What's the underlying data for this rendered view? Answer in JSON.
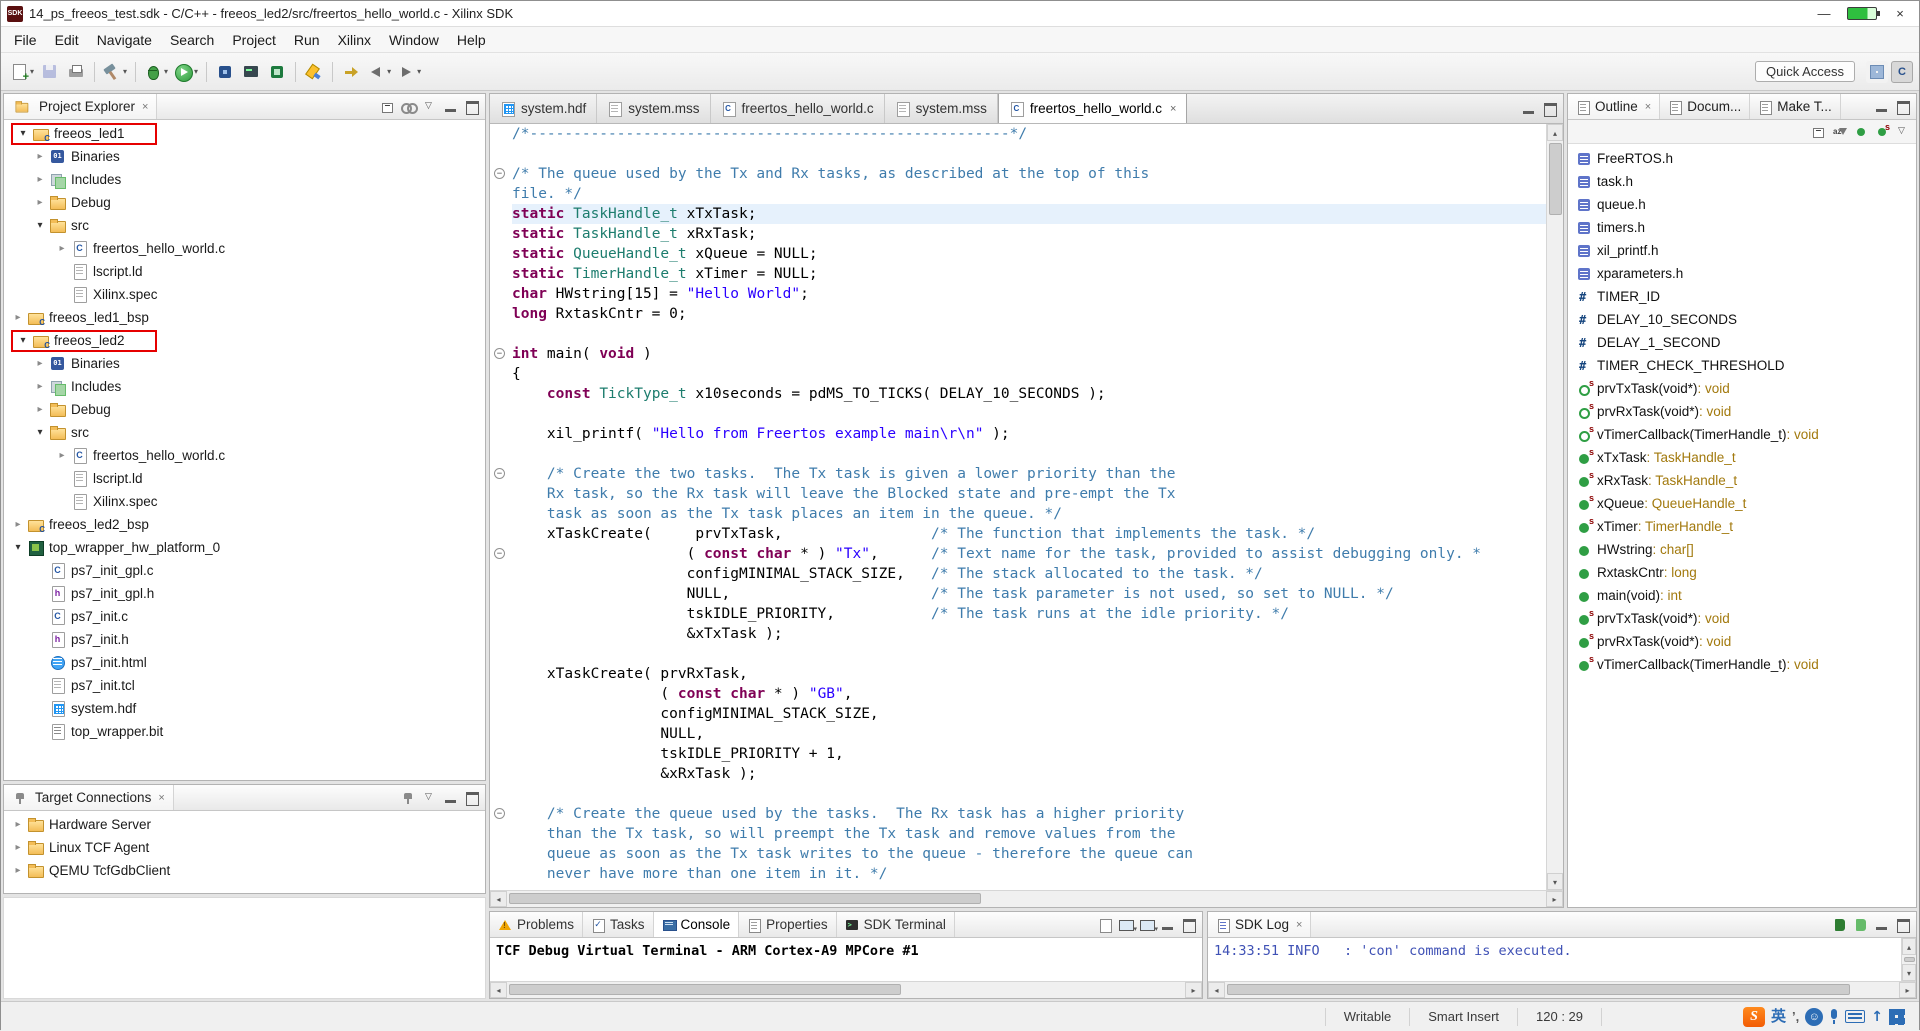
{
  "titlebar": {
    "title": "14_ps_freeos_test.sdk - C/C++ - freeos_led2/src/freertos_hello_world.c - Xilinx SDK",
    "app_badge": "SDK"
  },
  "menus": [
    "File",
    "Edit",
    "Navigate",
    "Search",
    "Project",
    "Run",
    "Xilinx",
    "Window",
    "Help"
  ],
  "toolbar": {
    "quick_access": "Quick Access",
    "items": [
      {
        "name": "new-wizard",
        "kind": "page-plus",
        "dd": true
      },
      {
        "name": "save",
        "kind": "floppy",
        "disabled": true
      },
      {
        "name": "print",
        "kind": "printer"
      },
      {
        "sep": true
      },
      {
        "name": "build",
        "kind": "hammer",
        "dd": true
      },
      {
        "sep": true
      },
      {
        "name": "debug",
        "kind": "bug",
        "dd": true
      },
      {
        "name": "run",
        "kind": "play",
        "dd": true
      },
      {
        "sep": true
      },
      {
        "name": "program-fpga",
        "kind": "chip"
      },
      {
        "name": "launch-shell",
        "kind": "terminal"
      },
      {
        "name": "create-boot-image",
        "kind": "chip2"
      },
      {
        "sep": true
      },
      {
        "name": "toggle-mark-occurrences",
        "kind": "marker"
      },
      {
        "sep": true
      },
      {
        "name": "last-edit-location",
        "kind": "edit-arrow"
      },
      {
        "name": "back",
        "kind": "arrow-left",
        "dd": true
      },
      {
        "name": "forward",
        "kind": "arrow-right",
        "dd": true
      }
    ]
  },
  "project_explorer": {
    "title": "Project Explorer",
    "items": [
      {
        "depth": 0,
        "arrow": "expanded",
        "icon": "folder-c",
        "label": "freeos_led1",
        "boxed": true
      },
      {
        "depth": 1,
        "arrow": "collapsed",
        "icon": "bin",
        "label": "Binaries"
      },
      {
        "depth": 1,
        "arrow": "collapsed",
        "icon": "inc",
        "label": "Includes"
      },
      {
        "depth": 1,
        "arrow": "collapsed",
        "icon": "folder",
        "label": "Debug"
      },
      {
        "depth": 1,
        "arrow": "expanded",
        "icon": "folder",
        "label": "src"
      },
      {
        "depth": 2,
        "arrow": "collapsed",
        "icon": "cfile",
        "label": "freertos_hello_world.c"
      },
      {
        "depth": 2,
        "arrow": null,
        "icon": "ldfile",
        "label": "lscript.ld"
      },
      {
        "depth": 2,
        "arrow": null,
        "icon": "specfile",
        "label": "Xilinx.spec"
      },
      {
        "depth": 0,
        "arrow": "collapsed",
        "icon": "folder-c",
        "label": "freeos_led1_bsp"
      },
      {
        "depth": 0,
        "arrow": "expanded",
        "icon": "folder-c",
        "label": "freeos_led2",
        "boxed": true
      },
      {
        "depth": 1,
        "arrow": "collapsed",
        "icon": "bin",
        "label": "Binaries"
      },
      {
        "depth": 1,
        "arrow": "collapsed",
        "icon": "inc",
        "label": "Includes"
      },
      {
        "depth": 1,
        "arrow": "collapsed",
        "icon": "folder",
        "label": "Debug"
      },
      {
        "depth": 1,
        "arrow": "expanded",
        "icon": "folder",
        "label": "src"
      },
      {
        "depth": 2,
        "arrow": "collapsed",
        "icon": "cfile",
        "label": "freertos_hello_world.c"
      },
      {
        "depth": 2,
        "arrow": null,
        "icon": "ldfile",
        "label": "lscript.ld"
      },
      {
        "depth": 2,
        "arrow": null,
        "icon": "specfile",
        "label": "Xilinx.spec"
      },
      {
        "depth": 0,
        "arrow": "collapsed",
        "icon": "folder-c",
        "label": "freeos_led2_bsp"
      },
      {
        "depth": 0,
        "arrow": "expanded",
        "icon": "board",
        "label": "top_wrapper_hw_platform_0"
      },
      {
        "depth": 1,
        "arrow": null,
        "icon": "cfile",
        "label": "ps7_init_gpl.c"
      },
      {
        "depth": 1,
        "arrow": null,
        "icon": "hfile",
        "label": "ps7_init_gpl.h"
      },
      {
        "depth": 1,
        "arrow": null,
        "icon": "cfile",
        "label": "ps7_init.c"
      },
      {
        "depth": 1,
        "arrow": null,
        "icon": "hfile",
        "label": "ps7_init.h"
      },
      {
        "depth": 1,
        "arrow": null,
        "icon": "htmlfile",
        "label": "ps7_init.html"
      },
      {
        "depth": 1,
        "arrow": null,
        "icon": "tclfile",
        "label": "ps7_init.tcl"
      },
      {
        "depth": 1,
        "arrow": null,
        "icon": "hdffile",
        "label": "system.hdf"
      },
      {
        "depth": 1,
        "arrow": null,
        "icon": "bitfile",
        "label": "top_wrapper.bit"
      }
    ]
  },
  "target_connections": {
    "title": "Target Connections",
    "items": [
      {
        "depth": 0,
        "arrow": "collapsed",
        "icon": "folder",
        "label": "Hardware Server"
      },
      {
        "depth": 0,
        "arrow": "collapsed",
        "icon": "folder",
        "label": "Linux TCF Agent"
      },
      {
        "depth": 0,
        "arrow": "collapsed",
        "icon": "folder",
        "label": "QEMU TcfGdbClient"
      }
    ]
  },
  "editor": {
    "tabs": [
      {
        "label": "system.hdf",
        "icon": "hdf"
      },
      {
        "label": "system.mss",
        "icon": "mss"
      },
      {
        "label": "freertos_hello_world.c",
        "icon": "c"
      },
      {
        "label": "system.mss",
        "icon": "mss"
      },
      {
        "label": "freertos_hello_world.c",
        "icon": "c",
        "active": true,
        "closable": true
      }
    ],
    "code": {
      "lines": [
        {
          "s": [
            [
              "c",
              "/*-------------------------------------------------------*/"
            ]
          ]
        },
        {
          "s": []
        },
        {
          "f": true,
          "s": [
            [
              "c",
              "/* The queue used by the Tx and Rx tasks, as described at the top of this"
            ]
          ]
        },
        {
          "s": [
            [
              "c",
              "file. */"
            ]
          ]
        },
        {
          "h": true,
          "s": [
            [
              "k",
              "static"
            ],
            [
              "p",
              " "
            ],
            [
              "t",
              "TaskHandle_t"
            ],
            [
              "p",
              " xTxTask;"
            ]
          ]
        },
        {
          "s": [
            [
              "k",
              "static"
            ],
            [
              "p",
              " "
            ],
            [
              "t",
              "TaskHandle_t"
            ],
            [
              "p",
              " xRxTask;"
            ]
          ]
        },
        {
          "s": [
            [
              "k",
              "static"
            ],
            [
              "p",
              " "
            ],
            [
              "t",
              "QueueHandle_t"
            ],
            [
              "p",
              " xQueue = NULL;"
            ]
          ]
        },
        {
          "s": [
            [
              "k",
              "static"
            ],
            [
              "p",
              " "
            ],
            [
              "t",
              "TimerHandle_t"
            ],
            [
              "p",
              " xTimer = NULL;"
            ]
          ]
        },
        {
          "s": [
            [
              "k",
              "char"
            ],
            [
              "p",
              " HWstring[15] = "
            ],
            [
              "s",
              "\"Hello World\""
            ],
            [
              "p",
              ";"
            ]
          ]
        },
        {
          "s": [
            [
              "k",
              "long"
            ],
            [
              "p",
              " RxtaskCntr = 0;"
            ]
          ]
        },
        {
          "s": []
        },
        {
          "f": true,
          "s": [
            [
              "k",
              "int"
            ],
            [
              "p",
              " main( "
            ],
            [
              "k",
              "void"
            ],
            [
              "p",
              " )"
            ]
          ]
        },
        {
          "s": [
            [
              "p",
              "{"
            ]
          ]
        },
        {
          "s": [
            [
              "p",
              "    "
            ],
            [
              "k",
              "const"
            ],
            [
              "p",
              " "
            ],
            [
              "t",
              "TickType_t"
            ],
            [
              "p",
              " x10seconds = pdMS_TO_TICKS( DELAY_10_SECONDS );"
            ]
          ]
        },
        {
          "s": []
        },
        {
          "s": [
            [
              "p",
              "    xil_printf( "
            ],
            [
              "s",
              "\"Hello from Freertos example main\\r\\n\""
            ],
            [
              "p",
              " );"
            ]
          ]
        },
        {
          "s": []
        },
        {
          "f": true,
          "s": [
            [
              "p",
              "    "
            ],
            [
              "c",
              "/* Create the two tasks.  The Tx task is given a lower priority than the"
            ]
          ]
        },
        {
          "s": [
            [
              "p",
              "    "
            ],
            [
              "c",
              "Rx task, so the Rx task will leave the Blocked state and pre-empt the Tx"
            ]
          ]
        },
        {
          "s": [
            [
              "p",
              "    "
            ],
            [
              "c",
              "task as soon as the Tx task places an item in the queue. */"
            ]
          ]
        },
        {
          "s": [
            [
              "p",
              "    xTaskCreate(     prvTxTask,                 "
            ],
            [
              "c",
              "/* The function that implements the task. */"
            ]
          ]
        },
        {
          "f": true,
          "s": [
            [
              "p",
              "                    ( "
            ],
            [
              "k",
              "const"
            ],
            [
              "p",
              " "
            ],
            [
              "k",
              "char"
            ],
            [
              "p",
              " * ) "
            ],
            [
              "s",
              "\"Tx\""
            ],
            [
              "p",
              ",      "
            ],
            [
              "c",
              "/* Text name for the task, provided to assist debugging only. *"
            ]
          ]
        },
        {
          "s": [
            [
              "p",
              "                    configMINIMAL_STACK_SIZE,   "
            ],
            [
              "c",
              "/* The stack allocated to the task. */"
            ]
          ]
        },
        {
          "s": [
            [
              "p",
              "                    NULL,                       "
            ],
            [
              "c",
              "/* The task parameter is not used, so set to NULL. */"
            ]
          ]
        },
        {
          "s": [
            [
              "p",
              "                    tskIDLE_PRIORITY,           "
            ],
            [
              "c",
              "/* The task runs at the idle priority. */"
            ]
          ]
        },
        {
          "s": [
            [
              "p",
              "                    &xTxTask );"
            ]
          ]
        },
        {
          "s": []
        },
        {
          "s": [
            [
              "p",
              "    xTaskCreate( prvRxTask,"
            ]
          ]
        },
        {
          "s": [
            [
              "p",
              "                 ( "
            ],
            [
              "k",
              "const"
            ],
            [
              "p",
              " "
            ],
            [
              "k",
              "char"
            ],
            [
              "p",
              " * ) "
            ],
            [
              "s",
              "\"GB\""
            ],
            [
              "p",
              ","
            ]
          ]
        },
        {
          "s": [
            [
              "p",
              "                 configMINIMAL_STACK_SIZE,"
            ]
          ]
        },
        {
          "s": [
            [
              "p",
              "                 NULL,"
            ]
          ]
        },
        {
          "s": [
            [
              "p",
              "                 tskIDLE_PRIORITY + 1,"
            ]
          ]
        },
        {
          "s": [
            [
              "p",
              "                 &xRxTask );"
            ]
          ]
        },
        {
          "s": []
        },
        {
          "f": true,
          "s": [
            [
              "p",
              "    "
            ],
            [
              "c",
              "/* Create the queue used by the tasks.  The Rx task has a higher priority"
            ]
          ]
        },
        {
          "s": [
            [
              "p",
              "    "
            ],
            [
              "c",
              "than the Tx task, so will preempt the Tx task and remove values from the"
            ]
          ]
        },
        {
          "s": [
            [
              "p",
              "    "
            ],
            [
              "c",
              "queue as soon as the Tx task writes to the queue - therefore the queue can"
            ]
          ]
        },
        {
          "s": [
            [
              "p",
              "    "
            ],
            [
              "c",
              "never have more than one item in it. */"
            ]
          ]
        }
      ]
    }
  },
  "outline": {
    "tabs": [
      {
        "label": "Outline",
        "active": true,
        "closable": true
      },
      {
        "label": "Docum..."
      },
      {
        "label": "Make T..."
      }
    ],
    "items": [
      {
        "icon": "inc",
        "label": "FreeRTOS.h"
      },
      {
        "icon": "inc",
        "label": "task.h"
      },
      {
        "icon": "inc",
        "label": "queue.h"
      },
      {
        "icon": "inc",
        "label": "timers.h"
      },
      {
        "icon": "inc",
        "label": "xil_printf.h"
      },
      {
        "icon": "inc",
        "label": "xparameters.h"
      },
      {
        "icon": "def",
        "label": "TIMER_ID"
      },
      {
        "icon": "def",
        "label": "DELAY_10_SECONDS"
      },
      {
        "icon": "def",
        "label": "DELAY_1_SECOND"
      },
      {
        "icon": "def",
        "label": "TIMER_CHECK_THRESHOLD"
      },
      {
        "icon": "fdecl",
        "label": "prvTxTask(void*)",
        "type": "void",
        "static": true
      },
      {
        "icon": "fdecl",
        "label": "prvRxTask(void*)",
        "type": "void",
        "static": true
      },
      {
        "icon": "fdecl",
        "label": "vTimerCallback(TimerHandle_t)",
        "type": "void",
        "static": true
      },
      {
        "icon": "var",
        "label": "xTxTask",
        "type": "TaskHandle_t",
        "static": true
      },
      {
        "icon": "var",
        "label": "xRxTask",
        "type": "TaskHandle_t",
        "static": true
      },
      {
        "icon": "var",
        "label": "xQueue",
        "type": "QueueHandle_t",
        "static": true
      },
      {
        "icon": "var",
        "label": "xTimer",
        "type": "TimerHandle_t",
        "static": true
      },
      {
        "icon": "var",
        "label": "HWstring",
        "type": "char[]"
      },
      {
        "icon": "var",
        "label": "RxtaskCntr",
        "type": "long"
      },
      {
        "icon": "func",
        "label": "main(void)",
        "type": "int"
      },
      {
        "icon": "func",
        "label": "prvTxTask(void*)",
        "type": "void",
        "static": true
      },
      {
        "icon": "func",
        "label": "prvRxTask(void*)",
        "type": "void",
        "static": true
      },
      {
        "icon": "func",
        "label": "vTimerCallback(TimerHandle_t)",
        "type": "void",
        "static": true
      }
    ]
  },
  "console": {
    "tabs": [
      {
        "label": "Problems",
        "icon": "problems"
      },
      {
        "label": "Tasks",
        "icon": "tasks"
      },
      {
        "label": "Console",
        "icon": "console",
        "active": true
      },
      {
        "label": "Properties",
        "icon": "props"
      },
      {
        "label": "SDK Terminal",
        "icon": "term"
      }
    ],
    "content": "TCF Debug Virtual Terminal - ARM Cortex-A9 MPCore #1"
  },
  "sdk_log": {
    "title": "SDK Log",
    "content": "14:33:51 INFO   : 'con' command is executed."
  },
  "statusbar": {
    "writable": "Writable",
    "insert_mode": "Smart Insert",
    "position": "120 : 29",
    "ime": [
      {
        "name": "sogou-logo",
        "kind": "sogou",
        "label": "S"
      },
      {
        "name": "language-toggle",
        "kind": "lang",
        "label": "英"
      },
      {
        "name": "punctuation-toggle",
        "kind": "punct",
        "label": "’,"
      },
      {
        "name": "emoji-picker",
        "kind": "emoji",
        "label": "☺"
      },
      {
        "name": "voice-input",
        "kind": "mic"
      },
      {
        "name": "soft-keyboard",
        "kind": "kb"
      },
      {
        "name": "ime-skin",
        "kind": "up",
        "label": "↑"
      },
      {
        "name": "ime-toolbox",
        "kind": "grid"
      }
    ]
  }
}
